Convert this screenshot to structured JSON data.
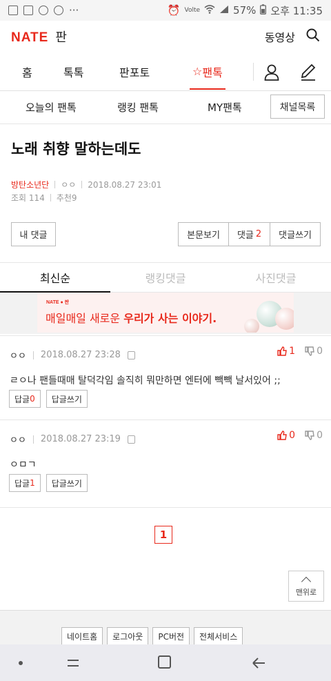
{
  "status": {
    "battery": "57%",
    "time": "오후 11:35",
    "carrier_mark": "Volte",
    "more": "···"
  },
  "header": {
    "logo_nate": "NATE",
    "logo_pan": "판",
    "video_label": "동영상"
  },
  "mainnav": {
    "items": [
      "홈",
      "톡톡",
      "판포토",
      "팬톡"
    ],
    "active_star": "☆"
  },
  "subnav": {
    "items": [
      "오늘의 팬톡",
      "랭킹 팬톡",
      "MY팬톡"
    ],
    "channel_button": "채널목록"
  },
  "article": {
    "title": "노래 취향 말하는데도",
    "author": "방탄소년단",
    "nickname": "ㅇㅇ",
    "date": "2018.08.27 23:01",
    "views_label": "조회",
    "views": "114",
    "recommend_label": "추천",
    "recommend": "9"
  },
  "buttons": {
    "my_comments": "내 댓글",
    "view_body": "본문보기",
    "comments_label": "댓글",
    "comments_count": "2",
    "write_comment": "댓글쓰기"
  },
  "comment_tabs": [
    "최신순",
    "랭킹댓글",
    "사진댓글"
  ],
  "ad": {
    "logo": "NATE ● 판",
    "text_normal": "매일매일 새로운 ",
    "text_bold": "우리가 사는 이야기."
  },
  "comments": [
    {
      "nick": "ㅇㅇ",
      "date": "2018.08.27 23:28",
      "up": "1",
      "down": "0",
      "body": "ㄹㅇ나 팬들때매 탈덕각임 솔직히 뭐만하면 엔터에 빽빽 날서있어 ;;",
      "reply_label": "답글",
      "reply_count": "0",
      "write_reply": "답글쓰기"
    },
    {
      "nick": "ㅇㅇ",
      "date": "2018.08.27 23:19",
      "up": "0",
      "down": "0",
      "body": "ㅇㅁㄱ",
      "reply_label": "답글",
      "reply_count": "1",
      "write_reply": "답글쓰기"
    }
  ],
  "pagination": {
    "current": "1"
  },
  "top_button": "맨위로",
  "footer": [
    "네이트홈",
    "로그아웃",
    "PC버전",
    "전체서비스"
  ],
  "colors": {
    "accent": "#e8291c"
  }
}
